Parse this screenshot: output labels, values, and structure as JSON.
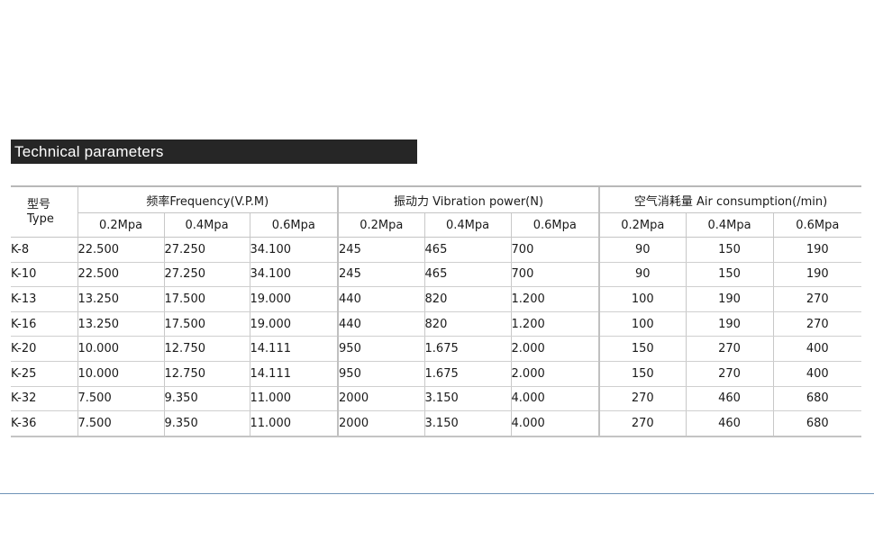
{
  "title": "Technical parameters",
  "table": {
    "type_header": {
      "cn": "型号",
      "en": "Type"
    },
    "groups": [
      {
        "label": "频率Frequency(V.P.M)"
      },
      {
        "label": "振动力 Vibration power(N)"
      },
      {
        "label": "空气消耗量 Air consumption(/min)"
      }
    ],
    "pressures": [
      "0.2Mpa",
      "0.4Mpa",
      "0.6Mpa"
    ],
    "rows": [
      {
        "type": "K-8",
        "freq": [
          "22.500",
          "27.250",
          "34.100"
        ],
        "vib": [
          "245",
          "465",
          "700"
        ],
        "air": [
          "90",
          "150",
          "190"
        ]
      },
      {
        "type": "K-10",
        "freq": [
          "22.500",
          "27.250",
          "34.100"
        ],
        "vib": [
          "245",
          "465",
          "700"
        ],
        "air": [
          "90",
          "150",
          "190"
        ]
      },
      {
        "type": "K-13",
        "freq": [
          "13.250",
          "17.500",
          "19.000"
        ],
        "vib": [
          "440",
          "820",
          "1.200"
        ],
        "air": [
          "100",
          "190",
          "270"
        ]
      },
      {
        "type": "K-16",
        "freq": [
          "13.250",
          "17.500",
          "19.000"
        ],
        "vib": [
          "440",
          "820",
          "1.200"
        ],
        "air": [
          "100",
          "190",
          "270"
        ]
      },
      {
        "type": "K-20",
        "freq": [
          "10.000",
          "12.750",
          "14.111"
        ],
        "vib": [
          "950",
          "1.675",
          "2.000"
        ],
        "air": [
          "150",
          "270",
          "400"
        ]
      },
      {
        "type": "K-25",
        "freq": [
          "10.000",
          "12.750",
          "14.111"
        ],
        "vib": [
          "950",
          "1.675",
          "2.000"
        ],
        "air": [
          "150",
          "270",
          "400"
        ]
      },
      {
        "type": "K-32",
        "freq": [
          "7.500",
          "9.350",
          "11.000"
        ],
        "vib": [
          "2000",
          "3.150",
          "4.000"
        ],
        "air": [
          "270",
          "460",
          "680"
        ]
      },
      {
        "type": "K-36",
        "freq": [
          "7.500",
          "9.350",
          "11.000"
        ],
        "vib": [
          "2000",
          "3.150",
          "4.000"
        ],
        "air": [
          "270",
          "460",
          "680"
        ]
      }
    ]
  },
  "colors": {
    "title_bar": "#262626",
    "bottom_rule": "#6f93b8"
  }
}
